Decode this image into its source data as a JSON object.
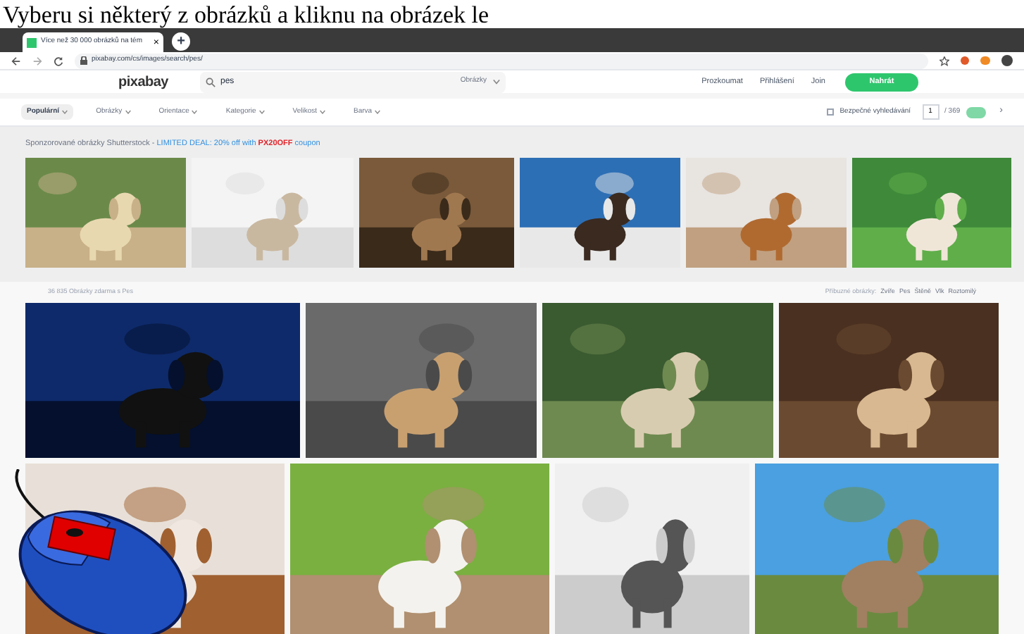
{
  "caption": "Vyberu si některý z obrázků a kliknu na obrázek le",
  "browser": {
    "tab": {
      "title": "Více než 30 000 obrázků na tém",
      "close": "×"
    },
    "new_tab": "+",
    "url": "pixabay.com/cs/images/search/pes/"
  },
  "header": {
    "logo": "pixabay",
    "search": {
      "value": "pes",
      "type": "Obrázky"
    },
    "nav": [
      "Prozkoumat",
      "Přihlášení",
      "Join"
    ],
    "upload": "Nahrát"
  },
  "filters": [
    {
      "label": "Populární",
      "selected": true
    },
    {
      "label": "Obrázky",
      "selected": false
    },
    {
      "label": "Orientace",
      "selected": false
    },
    {
      "label": "Kategorie",
      "selected": false
    },
    {
      "label": "Velikost",
      "selected": false
    },
    {
      "label": "Barva",
      "selected": false
    }
  ],
  "safe_search": {
    "label": "Bezpečné vyhledávání",
    "checked": false
  },
  "pagination": {
    "page": "1",
    "total": "/ 369",
    "next": "›"
  },
  "sponsored": {
    "parts": [
      {
        "kind": "plain",
        "text": "Sponzorované obrázky Shutterstock - "
      },
      {
        "kind": "link",
        "text": "LIMITED DEAL: 20% off with "
      },
      {
        "kind": "code",
        "text": "PX20OFF"
      },
      {
        "kind": "link",
        "text": " coupon"
      }
    ],
    "images": [
      {
        "kind": "picture"
      },
      {
        "kind": "picture"
      },
      {
        "kind": "picture"
      },
      {
        "kind": "picture"
      },
      {
        "kind": "picture"
      },
      {
        "kind": "picture"
      }
    ]
  },
  "results": {
    "count": "36 835 Obrázky zdarma s Pes",
    "related_label": "Příbuzné obrázky:",
    "related": [
      "Zvíře",
      "Pes",
      "Štěně",
      "Vlk",
      "Roztomilý"
    ],
    "rows": [
      [
        {
          "kind": "picture"
        },
        {
          "kind": "picture"
        },
        {
          "kind": "picture"
        },
        {
          "kind": "picture"
        }
      ],
      [
        {
          "kind": "picture"
        },
        {
          "kind": "picture"
        },
        {
          "kind": "picture"
        },
        {
          "kind": "picture"
        }
      ]
    ]
  }
}
